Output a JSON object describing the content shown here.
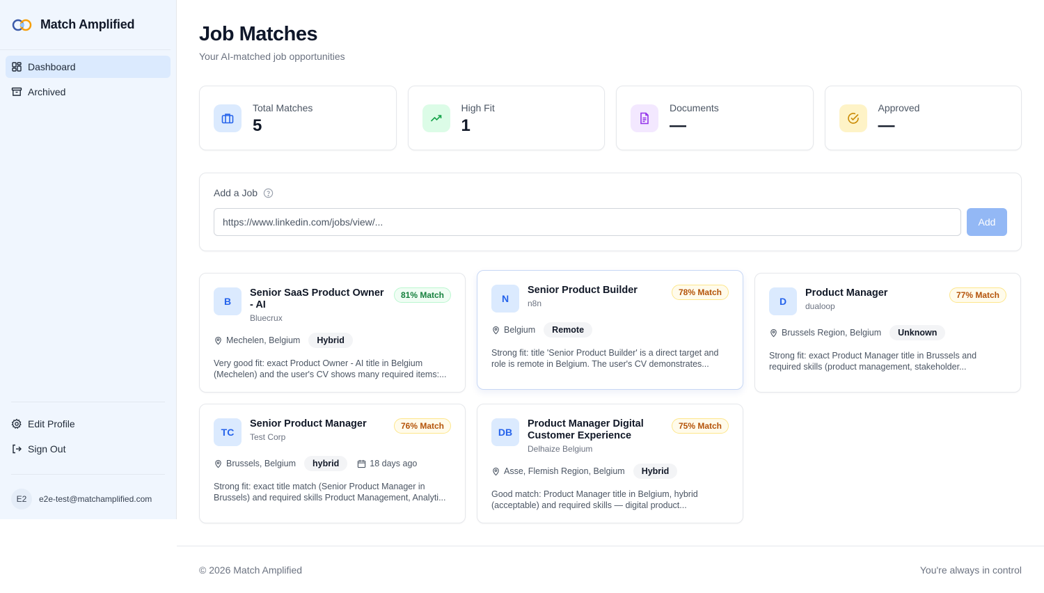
{
  "brand": {
    "name": "Match Amplified"
  },
  "sidebar": {
    "nav": [
      {
        "label": "Dashboard",
        "icon": "grid-icon",
        "active": true
      },
      {
        "label": "Archived",
        "icon": "archive-icon",
        "active": false
      }
    ],
    "bottom_nav": [
      {
        "label": "Edit Profile",
        "icon": "gear-icon"
      },
      {
        "label": "Sign Out",
        "icon": "sign-out-icon"
      }
    ],
    "user": {
      "initials": "E2",
      "email": "e2e-test@matchamplified.com"
    }
  },
  "page": {
    "title": "Job Matches",
    "subtitle": "Your AI-matched job opportunities"
  },
  "stats": [
    {
      "label": "Total Matches",
      "value": "5",
      "icon": "briefcase-icon",
      "color": "#2563eb",
      "bg": "#dbeafe"
    },
    {
      "label": "High Fit",
      "value": "1",
      "icon": "trending-up-icon",
      "color": "#16a34a",
      "bg": "#dcfce7"
    },
    {
      "label": "Documents",
      "value": "—",
      "icon": "document-icon",
      "color": "#9333ea",
      "bg": "#f3e8ff"
    },
    {
      "label": "Approved",
      "value": "—",
      "icon": "check-circle-icon",
      "color": "#ca8a04",
      "bg": "#fef3c7"
    }
  ],
  "add_job": {
    "title": "Add a Job",
    "placeholder": "https://www.linkedin.com/jobs/view/...",
    "button": "Add"
  },
  "jobs": [
    {
      "initials": "B",
      "title": "Senior SaaS Product Owner - AI",
      "company": "Bluecrux",
      "match": "81% Match",
      "match_level": "green",
      "location": "Mechelen, Belgium",
      "tag": "Hybrid",
      "date": "",
      "summary": "Very good fit: exact Product Owner - AI title in Belgium (Mechelen) and the user's CV shows many required items:..."
    },
    {
      "initials": "N",
      "title": "Senior Product Builder",
      "company": "n8n",
      "match": "78% Match",
      "match_level": "amber",
      "location": "Belgium",
      "tag": "Remote",
      "date": "",
      "summary": "Strong fit: title 'Senior Product Builder' is a direct target and role is remote in Belgium. The user's CV demonstrates..."
    },
    {
      "initials": "D",
      "title": "Product Manager",
      "company": "dualoop",
      "match": "77% Match",
      "match_level": "amber",
      "location": "Brussels Region, Belgium",
      "tag": "Unknown",
      "date": "",
      "summary": "Strong fit: exact Product Manager title in Brussels and required skills (product management, stakeholder..."
    },
    {
      "initials": "TC",
      "title": "Senior Product Manager",
      "company": "Test Corp",
      "match": "76% Match",
      "match_level": "amber",
      "location": "Brussels, Belgium",
      "tag": "hybrid",
      "date": "18 days ago",
      "summary": "Strong fit: exact title match (Senior Product Manager in Brussels) and required skills Product Management, Analyti..."
    },
    {
      "initials": "DB",
      "title": "Product Manager Digital Customer Experience",
      "company": "Delhaize Belgium",
      "match": "75% Match",
      "match_level": "amber",
      "location": "Asse, Flemish Region, Belgium",
      "tag": "Hybrid",
      "date": "",
      "summary": "Good match: Product Manager title in Belgium, hybrid (acceptable) and required skills — digital product..."
    }
  ],
  "footer": {
    "copyright": "© 2026 Match Amplified",
    "tagline": "You're always in control"
  }
}
